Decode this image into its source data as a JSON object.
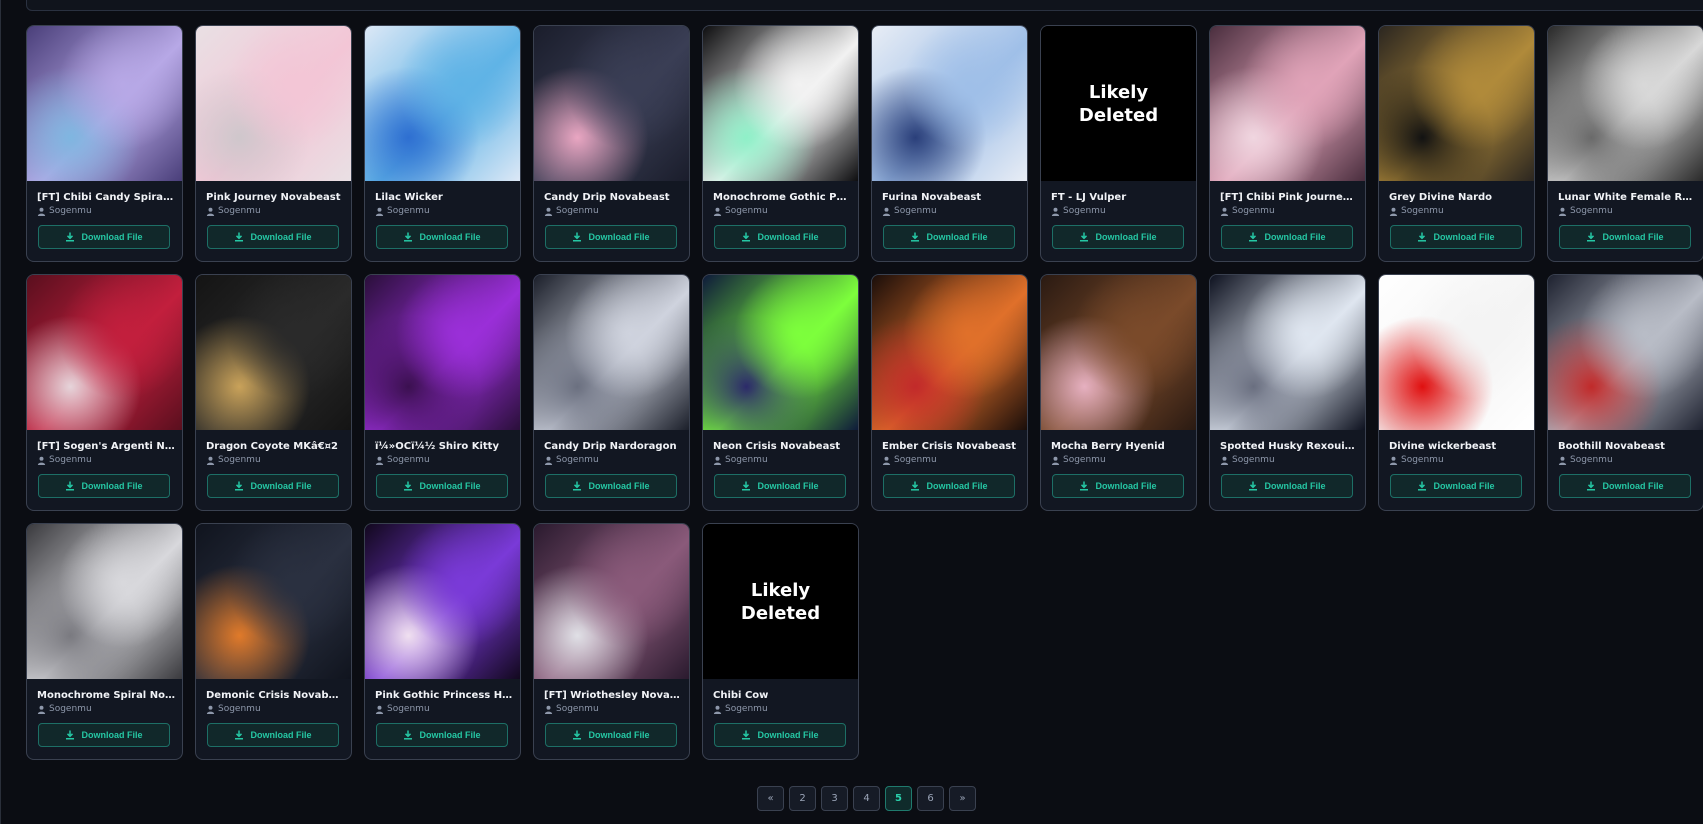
{
  "colors": {
    "accent": "#25c7a4",
    "card_bg": "#121722",
    "page_bg": "#0b0d13"
  },
  "download_label": "Download File",
  "deleted_label": [
    "Likely",
    "Deleted"
  ],
  "items": [
    {
      "title": "[FT]   Chibi Candy Spiral ...",
      "author": "Sogenmu",
      "thumb": [
        "#4a3f7a",
        "#b7a8e6",
        "#7fb6e0"
      ]
    },
    {
      "title": "Pink Journey Novabeast",
      "author": "Sogenmu",
      "thumb": [
        "#e9e0e4",
        "#f3c6d6",
        "#cfc7cc"
      ]
    },
    {
      "title": "Lilac Wicker",
      "author": "Sogenmu",
      "thumb": [
        "#dce8f6",
        "#5fb3e6",
        "#2e6fd1"
      ]
    },
    {
      "title": "Candy Drip Novabeast",
      "author": "Sogenmu",
      "thumb": [
        "#1a1d2b",
        "#3a3e55",
        "#e9a6c2"
      ]
    },
    {
      "title": "Monochrome Gothic Prin...",
      "author": "Sogenmu",
      "thumb": [
        "#0e0e10",
        "#f2f2f2",
        "#8ff0c8"
      ]
    },
    {
      "title": "Furina Novabeast",
      "author": "Sogenmu",
      "thumb": [
        "#e8edf5",
        "#9fbfe8",
        "#2a3f7a"
      ]
    },
    {
      "title": "FT - LJ Vulper",
      "author": "Sogenmu",
      "thumb": "deleted"
    },
    {
      "title": "[FT]   Chibi Pink Journey...",
      "author": "Sogenmu",
      "thumb": [
        "#4a2e3e",
        "#e0a3b8",
        "#f0d6e0"
      ]
    },
    {
      "title": "Grey Divine Nardo",
      "author": "Sogenmu",
      "thumb": [
        "#2b2620",
        "#b08a3a",
        "#121212"
      ]
    },
    {
      "title": "Lunar White Female Rexo...",
      "author": "Sogenmu",
      "thumb": [
        "#2a2a2a",
        "#d8d8d8",
        "#6a6a6a"
      ]
    },
    {
      "title": "[FT]   Sogen's Argenti N...",
      "author": "Sogenmu",
      "thumb": [
        "#5a0f1e",
        "#c21f3d",
        "#e6d4da"
      ]
    },
    {
      "title": "Dragon Coyote MKâ€¤2",
      "author": "Sogenmu",
      "thumb": [
        "#141414",
        "#2a2a2a",
        "#c9a25a"
      ]
    },
    {
      "title": "ï¼»OCï¼½ Shiro Kitty",
      "author": "Sogenmu",
      "thumb": [
        "#2a0f3a",
        "#9a2fd8",
        "#3b1050"
      ]
    },
    {
      "title": "Candy Drip Nardoragon",
      "author": "Sogenmu",
      "thumb": [
        "#1b1f2a",
        "#cfd3de",
        "#6b7080"
      ]
    },
    {
      "title": "Neon Crisis Novabeast",
      "author": "Sogenmu",
      "thumb": [
        "#0e1a3a",
        "#7dff3c",
        "#2c2a6a"
      ]
    },
    {
      "title": "Ember Crisis Novabeast",
      "author": "Sogenmu",
      "thumb": [
        "#1a0e0a",
        "#e0702a",
        "#c22a2a"
      ]
    },
    {
      "title": "Mocha Berry Hyenid",
      "author": "Sogenmu",
      "thumb": [
        "#2a1a12",
        "#7a4a2a",
        "#e6b0c0"
      ]
    },
    {
      "title": "Spotted Husky Rexouium",
      "author": "Sogenmu",
      "thumb": [
        "#0e1220",
        "#dfe6f0",
        "#6a6f80"
      ]
    },
    {
      "title": "Divine wickerbeast",
      "author": "Sogenmu",
      "thumb": [
        "#ffffff",
        "#f4f4f4",
        "#e01010"
      ]
    },
    {
      "title": "Boothill Novabeast",
      "author": "Sogenmu",
      "thumb": [
        "#1e2230",
        "#b8bcc6",
        "#c12a2a"
      ]
    },
    {
      "title": "Monochrome Spiral Nova...",
      "author": "Sogenmu",
      "thumb": [
        "#3a3a3e",
        "#d8d8dc",
        "#7a7a80"
      ]
    },
    {
      "title": "Demonic Crisis Novabeast",
      "author": "Sogenmu",
      "thumb": [
        "#10141e",
        "#2a3040",
        "#e07a2a"
      ]
    },
    {
      "title": "Pink Gothic Princess Hye...",
      "author": "Sogenmu",
      "thumb": [
        "#12081e",
        "#7a3ad8",
        "#f0e0f0"
      ]
    },
    {
      "title": "[FT]   Wriothesley Novab...",
      "author": "Sogenmu",
      "thumb": [
        "#2a1a2e",
        "#8a5a7a",
        "#e0e0e6"
      ]
    },
    {
      "title": "Chibi Cow",
      "author": "Sogenmu",
      "thumb": "deleted"
    }
  ],
  "pagination": [
    "«",
    "2",
    "3",
    "4",
    "5",
    "6",
    "»"
  ],
  "pagination_active": 4
}
